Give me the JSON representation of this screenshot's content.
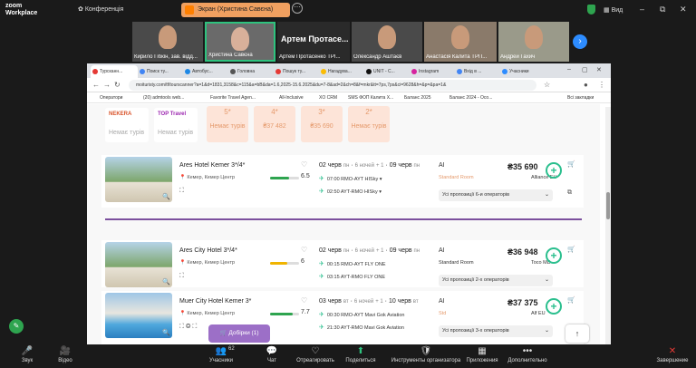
{
  "zoom": {
    "logo_line1": "zoom",
    "logo_line2": "Workplace",
    "conference": "Конференція",
    "share_label": "Экран (Христина Савєна)",
    "view": "Вид",
    "win_min": "–",
    "win_max": "⧉",
    "win_close": "✕"
  },
  "participants": [
    {
      "name": "Кирило Гібкін, зав. відд..."
    },
    {
      "name": "Христина Савєна"
    },
    {
      "name": "Артем Протасе...",
      "sub": "Артем Протасенко ТРІ..."
    },
    {
      "name": "Олександр Аштаєв"
    },
    {
      "name": "Анастасія Калита ТРП..."
    },
    {
      "name": "Андрей Гахич"
    }
  ],
  "browser": {
    "tabs": [
      "Турсканн...",
      "Поиск ту...",
      "Автобус...",
      "Головна",
      "Пошук ту...",
      "Нагадува...",
      "UNIT - С...",
      "Instagram",
      "Вхід в ...",
      "Учасники"
    ],
    "url": "moituristy.com/tf/tourscanner?a=1&d=1831,3158&c=115&a=bB&da=1.6,2025-15.6.2025&du=7-8&ad=2&ch=8&f=mkr&tt=7ps,7ps&ci=9628&h=&p=&pa=1&",
    "bookmarks": [
      "Оператори",
      "(20) admtools web...",
      "Favorite Travel Agen...",
      "All-Inclusive",
      "XO CRM",
      "SMS ФОП Калита Х...",
      "Баланс 2025",
      "Баланс 2024 - Осо...",
      "Всі закладки"
    ]
  },
  "operators": [
    {
      "logo": "NEKERA",
      "none": "Немає турів"
    },
    {
      "logo": "TOP Travel",
      "none": "Немає турів"
    }
  ],
  "stars": [
    {
      "stars": "5*",
      "price": "Немає турів"
    },
    {
      "stars": "4*",
      "price": "₴37 482"
    },
    {
      "stars": "3*",
      "price": "₴35 690"
    },
    {
      "stars": "2*",
      "price": "Немає турів"
    }
  ],
  "hotels": [
    {
      "name": "Ares Hotel Kemer 3*/4*",
      "location": "Кемер, Кемер Центр",
      "rating": "6.5",
      "date_from": "02 черв",
      "dow_from": "пн",
      "nights": "6 ночей",
      "plus": "+ 1",
      "date_to": "09 черв",
      "dow_to": "пн",
      "flight1": "07:00 RMO-AYT HISky",
      "flight2": "02:50 AYT-RMO HISky",
      "meal": "AI",
      "room": "Standard Room",
      "price": "₴35 690",
      "operator": "Alliance EU",
      "all_props": "Усі пропозиції 6-и операторів"
    },
    {
      "name": "Ares City Hotel 3*/4*",
      "location": "Кемер, Кемер Центр",
      "rating": "6",
      "date_from": "02 черв",
      "dow_from": "пн",
      "nights": "6 ночей",
      "plus": "+ 1",
      "date_to": "09 черв",
      "dow_to": "пн",
      "flight1": "00:15 RMO-AYT FLY ONE",
      "flight2": "03:15 AYT-RMO FLY ONE",
      "meal": "AI",
      "room": "Standard Room",
      "price": "₴36 948",
      "operator": "Toco MD",
      "all_props": "Усі пропозиції 2-х операторів"
    },
    {
      "name": "Muer City Hotel Kemer 3*",
      "location": "Кемер, Кемер Центр",
      "rating": "7.7",
      "date_from": "03 черв",
      "dow_from": "вт",
      "nights": "6 ночей",
      "plus": "+ 1",
      "date_to": "10 черв",
      "dow_to": "вт",
      "flight1": "00:30 RMO-AYT Mavi Gok Aviation",
      "flight2": "21:30 AYT-RMO Mavi Gok Aviation",
      "meal": "AI",
      "room": "Std",
      "price": "₴37 375",
      "operator": "Alf EU",
      "all_props": "Усі пропозиції 3-х операторів"
    }
  ],
  "rating_colors": [
    "#2ea44f",
    "#f0b400",
    "#2ea44f"
  ],
  "rating_fill": [
    0.65,
    0.6,
    0.77
  ],
  "dobirky": "Добірки (1)",
  "toolbar": [
    {
      "icon": "🎤",
      "label": "Звук"
    },
    {
      "icon": "🎥",
      "label": "Відео"
    },
    {
      "icon": "👥",
      "label": "Учасники",
      "badge": "62"
    },
    {
      "icon": "💬",
      "label": "Чат"
    },
    {
      "icon": "♡",
      "label": "Отреагировать"
    },
    {
      "icon": "⬆",
      "label": "Поделиться"
    },
    {
      "icon": "🛡",
      "label": "Инструменты организатора"
    },
    {
      "icon": "▦",
      "label": "Приложения"
    },
    {
      "icon": "•••",
      "label": "Дополнительно"
    },
    {
      "icon": "✕",
      "label": "Завершение"
    }
  ]
}
